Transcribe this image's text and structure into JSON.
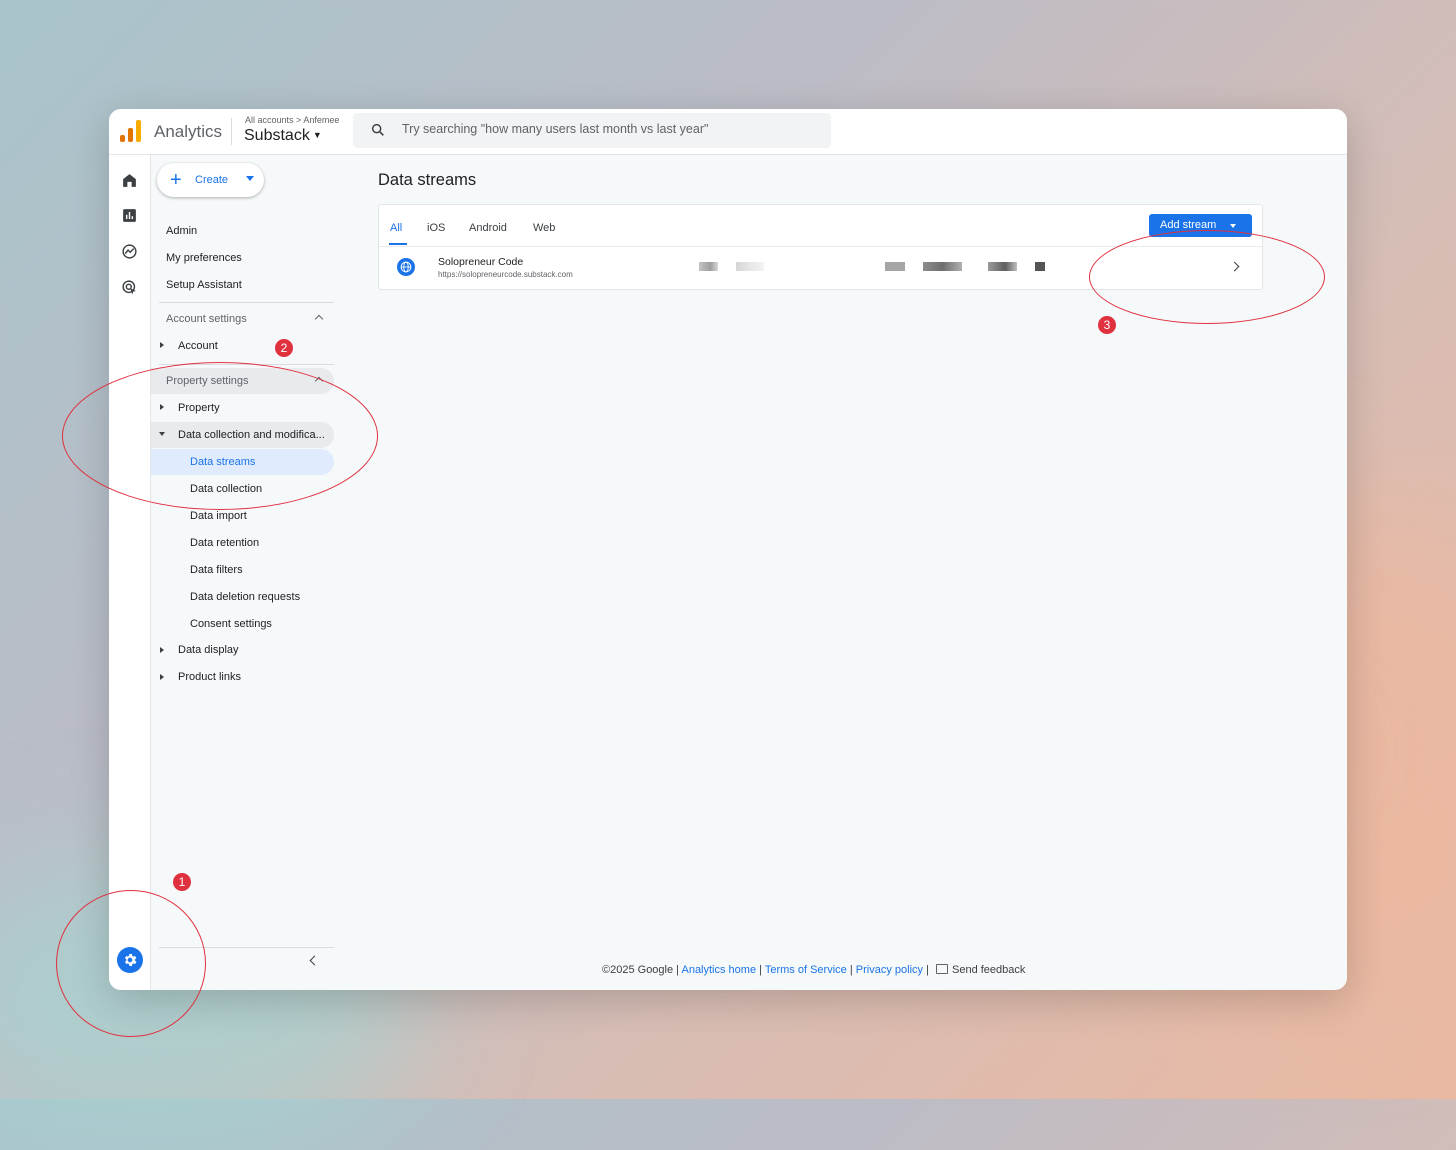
{
  "app": {
    "name": "Analytics",
    "breadcrumb": [
      "All accounts",
      "Anfemee"
    ],
    "property": "Substack"
  },
  "search": {
    "placeholder": "Try searching \"how many users last month vs last year\""
  },
  "sidebar": {
    "create_label": "Create",
    "top_items": [
      "Admin",
      "My preferences",
      "Setup Assistant"
    ],
    "account_settings": {
      "label": "Account settings",
      "items": [
        "Account"
      ]
    },
    "property_settings": {
      "label": "Property settings",
      "property": "Property",
      "data_collection": "Data collection and modifica...",
      "sub_items": [
        "Data streams",
        "Data collection",
        "Data import",
        "Data retention",
        "Data filters",
        "Data deletion requests",
        "Consent settings"
      ],
      "data_display": "Data display",
      "product_links": "Product links"
    }
  },
  "main": {
    "title": "Data streams",
    "tabs": [
      "All",
      "iOS",
      "Android",
      "Web"
    ],
    "active_tab": "All",
    "add_stream_label": "Add stream",
    "streams": [
      {
        "name": "Solopreneur Code",
        "url": "https://solopreneurcode.substack.com",
        "type_icon": "globe-icon"
      }
    ]
  },
  "footer": {
    "copyright": "©2025 Google |",
    "links": [
      "Analytics home",
      "Terms of Service",
      "Privacy policy"
    ],
    "feedback": "Send feedback"
  },
  "annotations": [
    "1",
    "2",
    "3"
  ],
  "colors": {
    "accent": "#1a73e8",
    "annotation": "#e0313f",
    "active_bg": "#e0ecfd"
  }
}
